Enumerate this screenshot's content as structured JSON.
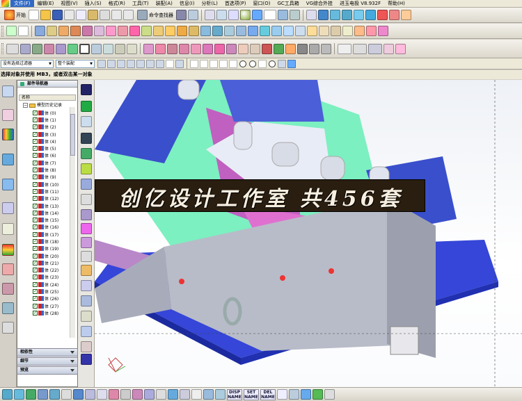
{
  "menu": [
    "文件(F)",
    "编辑(E)",
    "视图(V)",
    "插入(S)",
    "格式(R)",
    "工具(T)",
    "装配(A)",
    "信息(I)",
    "分析(L)",
    "首选项(P)",
    "窗口(O)",
    "GC工具箱",
    "VG综合外挂",
    "进玉电极 V8.932F",
    "帮助(H)"
  ],
  "toolbar": {
    "start_label": "开始",
    "command_finder_label": "命令查找器"
  },
  "selection_bar": {
    "filter_dropdown": "没有选择过滤器",
    "scope_dropdown": "整个装配"
  },
  "cue_line": "选择对象并使用 MB3，或者双击某一对象",
  "navigator": {
    "title": "部件导航器",
    "column_header": "名称",
    "root_label": "模型历史记录",
    "rows": [
      "体 (0)",
      "体 (1)",
      "体 (2)",
      "体 (3)",
      "体 (4)",
      "体 (5)",
      "体 (6)",
      "体 (7)",
      "体 (8)",
      "体 (9)",
      "体 (10)",
      "体 (11)",
      "体 (12)",
      "体 (13)",
      "体 (14)",
      "体 (15)",
      "体 (16)",
      "体 (17)",
      "体 (18)",
      "体 (19)",
      "体 (20)",
      "体 (21)",
      "体 (22)",
      "体 (23)",
      "体 (24)",
      "体 (25)",
      "体 (26)",
      "体 (27)",
      "体 (28)"
    ],
    "panels": [
      "相依性",
      "细节",
      "预览"
    ]
  },
  "banner_text": "创亿设计工作室  共456套",
  "bottom_toolbar": {
    "disp_name": [
      "DISP",
      "NAME"
    ],
    "set_name": [
      "SET",
      "NAME"
    ],
    "del_name": [
      "DEL",
      "NAME"
    ]
  }
}
